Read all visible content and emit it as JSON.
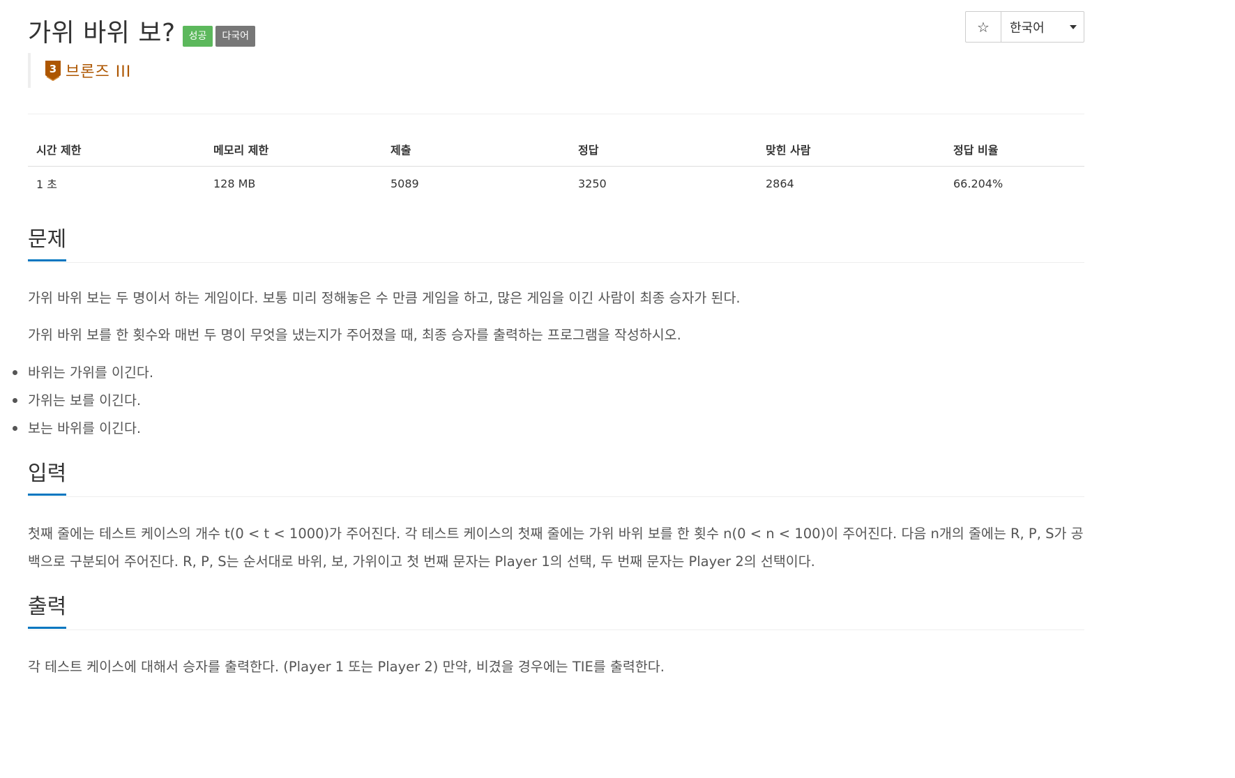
{
  "header": {
    "title": "가위 바위 보?",
    "labels": [
      "성공",
      "다국어"
    ],
    "star_icon": "star-icon",
    "language": "한국어"
  },
  "tier": {
    "number": "3",
    "name": "브론즈 III",
    "color": "#ad5600"
  },
  "info_table": {
    "headers": [
      "시간 제한",
      "메모리 제한",
      "제출",
      "정답",
      "맞힌 사람",
      "정답 비율"
    ],
    "values": [
      "1 초",
      "128 MB",
      "5089",
      "3250",
      "2864",
      "66.204%"
    ]
  },
  "sections": {
    "problem": {
      "title": "문제",
      "paragraphs": [
        "가위 바위 보는 두 명이서 하는 게임이다. 보통 미리 정해놓은 수 만큼 게임을 하고, 많은 게임을 이긴 사람이 최종 승자가 된다.",
        "가위 바위 보를 한 횟수와 매번 두 명이 무엇을 냈는지가 주어졌을 때, 최종 승자를 출력하는 프로그램을 작성하시오."
      ],
      "bullets": [
        "바위는 가위를 이긴다.",
        "가위는 보를 이긴다.",
        "보는 바위를 이긴다."
      ]
    },
    "input": {
      "title": "입력",
      "text": "첫째 줄에는 테스트 케이스의 개수 t(0 < t < 1000)가 주어진다. 각 테스트 케이스의 첫째 줄에는 가위 바위 보를 한 횟수 n(0 < n < 100)이 주어진다. 다음 n개의 줄에는 R, P, S가 공백으로 구분되어 주어진다. R, P, S는 순서대로 바위, 보, 가위이고 첫 번째 문자는 Player 1의 선택, 두 번째 문자는 Player 2의 선택이다."
    },
    "output": {
      "title": "출력",
      "text": "각 테스트 케이스에 대해서 승자를 출력한다. (Player 1 또는 Player 2) 만약, 비겼을 경우에는 TIE를 출력한다."
    }
  },
  "colors": {
    "success_label": "#5cb85c",
    "default_label": "#777777",
    "section_underline": "#0076c0",
    "tier_bronze": "#ad5600"
  }
}
